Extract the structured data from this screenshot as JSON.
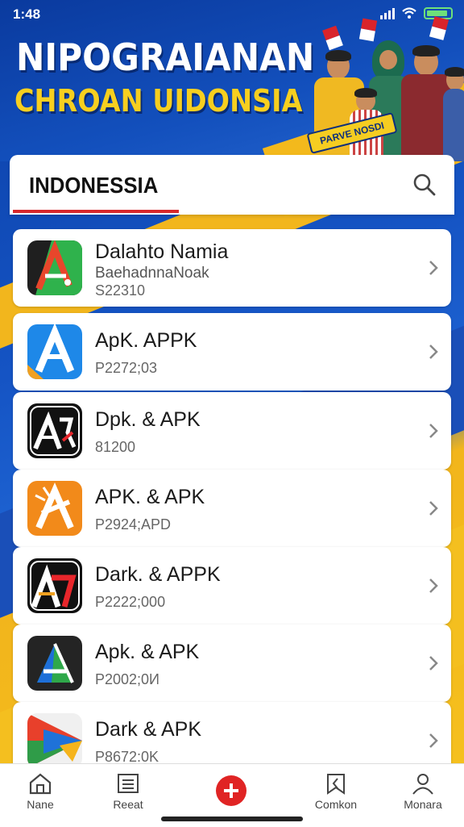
{
  "status_bar": {
    "time": "1:48"
  },
  "banner": {
    "title": "NIPOGRAIANAN",
    "subtitle": "CHROAN UIDONSIA",
    "tag": "PARVE NOSDI"
  },
  "search": {
    "tab_label": "INDONESSIA"
  },
  "apps": [
    {
      "title": "Dalahto Namia",
      "subtitle": "BaehadnnaNoak",
      "meta": "S22310"
    },
    {
      "title": "ApK. APPK",
      "meta": "P2272;03"
    },
    {
      "title": "Dpk. & APK",
      "meta": "81200"
    },
    {
      "title": "APK. & APK",
      "meta": "P2924;APD"
    },
    {
      "title": "Dark. &  APPK",
      "meta": "P2222;000"
    },
    {
      "title": "Apk. & APK",
      "meta": "P2002;0И"
    },
    {
      "title": "Dark & APK",
      "meta": "P8672:0K"
    }
  ],
  "nav": {
    "home": "Nane",
    "recent": "Reeat",
    "center": "+",
    "comments": "Comkon",
    "profile": "Monara"
  },
  "colors": {
    "accent": "#e02424",
    "brand_blue": "#1350bd",
    "brand_gold": "#f3b91c"
  }
}
